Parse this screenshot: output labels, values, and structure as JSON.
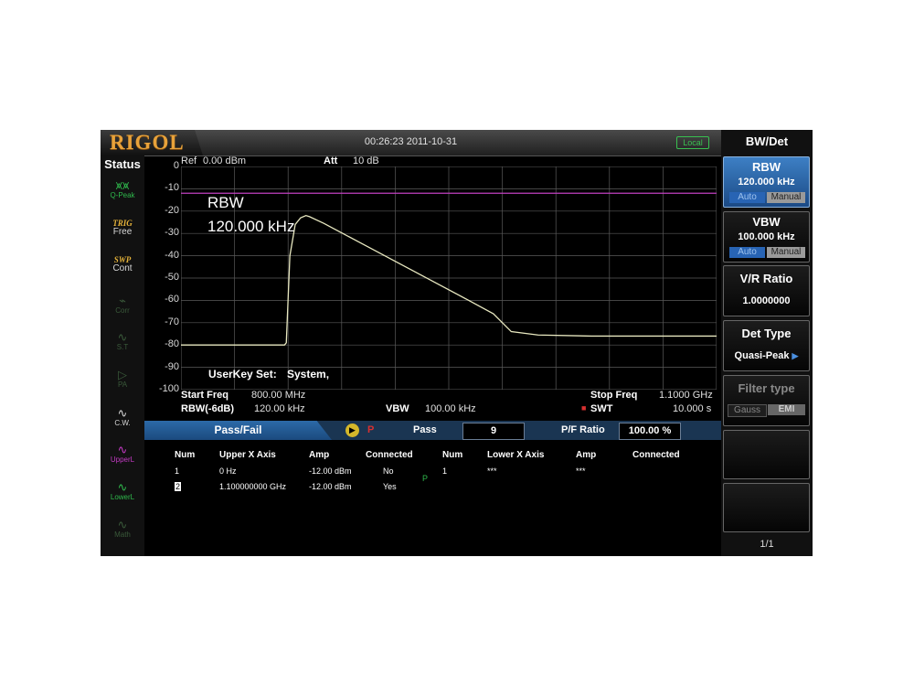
{
  "header": {
    "logo": "RIGOL",
    "datetime": "00:26:23 2011-10-31",
    "local_label": "Local"
  },
  "status": {
    "title": "Status",
    "items": [
      {
        "top": "",
        "bottom": "Q-Peak"
      },
      {
        "top": "TRIG",
        "bottom": "Free"
      },
      {
        "top": "SWP",
        "bottom": "Cont"
      },
      {
        "top": "",
        "bottom": "Corr"
      },
      {
        "top": "",
        "bottom": "S.T"
      },
      {
        "top": "",
        "bottom": "PA"
      },
      {
        "top": "",
        "bottom": "C.W."
      },
      {
        "top": "",
        "bottom": "UpperL"
      },
      {
        "top": "",
        "bottom": "LowerL"
      },
      {
        "top": "",
        "bottom": "Math"
      }
    ]
  },
  "trace_header": {
    "ref_label": "Ref",
    "ref_value": "0.00 dBm",
    "att_label": "Att",
    "att_value": "10 dB"
  },
  "overlay": {
    "rbw_label": "RBW",
    "rbw_value": "120.000 kHz",
    "userkey_label": "UserKey Set:",
    "userkey_value": "System,"
  },
  "footer": {
    "start_label": "Start Freq",
    "start_value": "800.00 MHz",
    "stop_label": "Stop Freq",
    "stop_value": "1.1000 GHz",
    "rbw6_label": "RBW(-6dB)",
    "rbw6_value": "120.00 kHz",
    "vbw_label": "VBW",
    "vbw_value": "100.00 kHz",
    "swt_label": "SWT",
    "swt_value": "10.000 s"
  },
  "passfail": {
    "title": "Pass/Fail",
    "p_marker": "P",
    "pass_label": "Pass",
    "pass_count": "9",
    "ratio_label": "P/F Ratio",
    "ratio_value": "100.00 %"
  },
  "table": {
    "upper_headers": [
      "Num",
      "Upper X Axis",
      "Amp",
      "Connected"
    ],
    "lower_headers": [
      "Num",
      "Lower X Axis",
      "Amp",
      "Connected"
    ],
    "upper_rows": [
      [
        "1",
        "0 Hz",
        "-12.00 dBm",
        "No"
      ],
      [
        "2",
        "1.100000000 GHz",
        "-12.00 dBm",
        "Yes"
      ]
    ],
    "lower_rows": [
      [
        "1",
        "***",
        "***",
        ""
      ]
    ],
    "mid_marker": "P"
  },
  "softkeys": {
    "menu_title": "BW/Det",
    "rbw": {
      "label": "RBW",
      "value": "120.000 kHz",
      "auto": "Auto",
      "manual": "Manual"
    },
    "vbw": {
      "label": "VBW",
      "value": "100.000 kHz",
      "auto": "Auto",
      "manual": "Manual"
    },
    "vr_ratio": {
      "label": "V/R Ratio",
      "value": "1.0000000"
    },
    "det_type": {
      "label": "Det Type",
      "value": "Quasi-Peak"
    },
    "filter_type": {
      "label": "Filter type",
      "gauss": "Gauss",
      "emi": "EMI"
    },
    "page": "1/1"
  },
  "colors": {
    "trace": "#e8e8c0",
    "limit_line": "#c040c0",
    "grid": "#5a5a5a",
    "accent_blue": "#2c6aa8",
    "logo": "#e8a23a"
  },
  "chart_data": {
    "type": "line",
    "y_axis": {
      "unit": "dBm",
      "range": [
        -100,
        0
      ],
      "ticks": [
        0,
        -10,
        -20,
        -30,
        -40,
        -50,
        -60,
        -70,
        -80,
        -90,
        -100
      ]
    },
    "x_axis": {
      "range_mhz": [
        800,
        1100
      ],
      "start_label": "800.00 MHz",
      "stop_label": "1.1000 GHz"
    },
    "grid": true,
    "series": [
      {
        "x_mhz": [
          800,
          858,
          859,
          861,
          864,
          867,
          870,
          872,
          880,
          900,
          920,
          940,
          960,
          975,
          985,
          1000,
          1030,
          1100
        ],
        "y_dbm": [
          -80,
          -80,
          -79,
          -40,
          -26,
          -23,
          -22,
          -22.5,
          -25.5,
          -34,
          -42.5,
          -51,
          -59.5,
          -66,
          -74,
          -75.5,
          -76,
          -76
        ]
      },
      {
        "x_mhz": [
          800,
          1100
        ],
        "y_dbm": [
          -12,
          -12
        ]
      }
    ]
  }
}
